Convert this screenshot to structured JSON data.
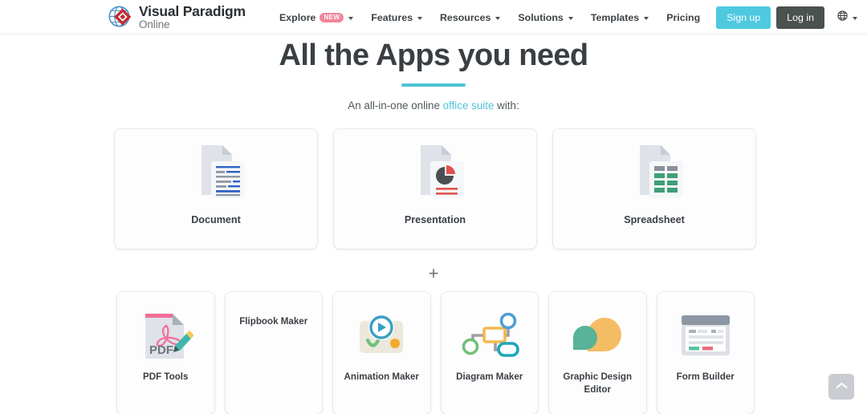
{
  "header": {
    "logo": {
      "line1": "Visual Paradigm",
      "line2": "Online",
      "icon": "globe-diamond-logo-icon"
    },
    "nav": [
      {
        "label": "Explore",
        "badge": "NEW",
        "caret": true
      },
      {
        "label": "Features",
        "badge": null,
        "caret": true
      },
      {
        "label": "Resources",
        "badge": null,
        "caret": true
      },
      {
        "label": "Solutions",
        "badge": null,
        "caret": true
      },
      {
        "label": "Templates",
        "badge": null,
        "caret": true
      },
      {
        "label": "Pricing",
        "badge": null,
        "caret": false
      }
    ],
    "sign_up_label": "Sign up",
    "log_in_label": "Log in",
    "language_icon": "globe-icon"
  },
  "hero": {
    "title": "All the Apps you need",
    "subtitle_before": "An all-in-one online ",
    "subtitle_link": "office suite",
    "subtitle_after": " with:"
  },
  "primary_apps": [
    {
      "label": "Document",
      "icon": "document-file-icon"
    },
    {
      "label": "Presentation",
      "icon": "presentation-file-icon"
    },
    {
      "label": "Spreadsheet",
      "icon": "spreadsheet-file-icon"
    }
  ],
  "divider_symbol": "+",
  "secondary_apps": [
    {
      "label": "PDF Tools",
      "icon": "pdf-tools-icon",
      "has_icon": true
    },
    {
      "label": "Flipbook Maker",
      "icon": "flipbook-maker-icon",
      "has_icon": false
    },
    {
      "label": "Animation Maker",
      "icon": "animation-maker-icon",
      "has_icon": true
    },
    {
      "label": "Diagram Maker",
      "icon": "diagram-maker-icon",
      "has_icon": true
    },
    {
      "label": "Graphic Design Editor",
      "icon": "graphic-design-icon",
      "has_icon": true
    },
    {
      "label": "Form Builder",
      "icon": "form-builder-icon",
      "has_icon": true
    }
  ],
  "scroll_top": {
    "icon": "chevron-up-icon"
  },
  "colors": {
    "accent_teal": "#4ec3d8",
    "signup_button": "#4ec9e0",
    "login_button": "#4b514e",
    "badge_pink": "#f1869b",
    "heading_text": "#3a3f44",
    "page_background": "#ffffff"
  }
}
